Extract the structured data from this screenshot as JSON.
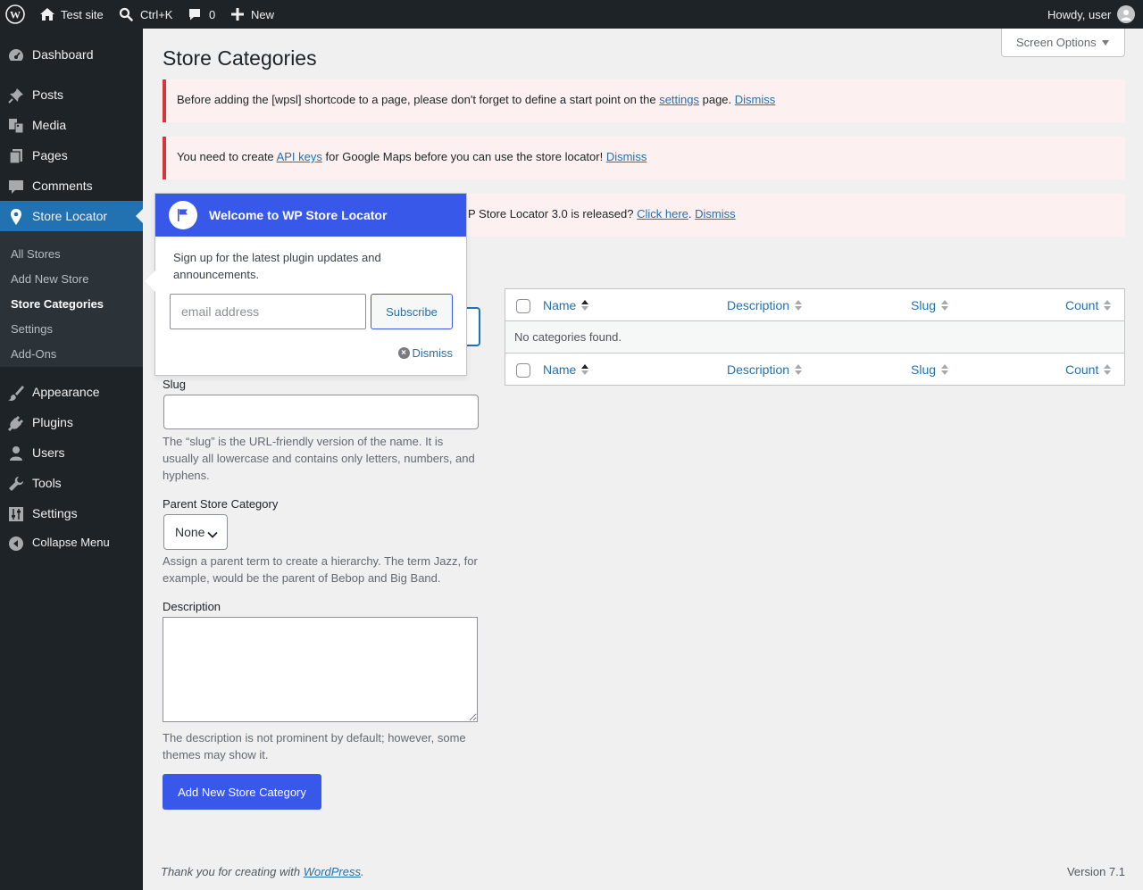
{
  "adminbar": {
    "site_name": "Test site",
    "search_shortcut": "Ctrl+K",
    "comments_count": "0",
    "new_label": "New",
    "howdy": "Howdy, user"
  },
  "sidebar": {
    "items": [
      {
        "label": "Dashboard",
        "icon": "dashboard-icon"
      },
      {
        "label": "Posts",
        "icon": "pin-icon"
      },
      {
        "label": "Media",
        "icon": "media-icon"
      },
      {
        "label": "Pages",
        "icon": "pages-icon"
      },
      {
        "label": "Comments",
        "icon": "comment-icon"
      },
      {
        "label": "Store Locator",
        "icon": "location-pin-icon"
      },
      {
        "label": "Appearance",
        "icon": "brush-icon"
      },
      {
        "label": "Plugins",
        "icon": "plug-icon"
      },
      {
        "label": "Users",
        "icon": "user-icon"
      },
      {
        "label": "Tools",
        "icon": "wrench-icon"
      },
      {
        "label": "Settings",
        "icon": "sliders-icon"
      },
      {
        "label": "Collapse Menu",
        "icon": "collapse-icon"
      }
    ],
    "submenu": [
      "All Stores",
      "Add New Store",
      "Store Categories",
      "Settings",
      "Add-Ons"
    ]
  },
  "page": {
    "title": "Store Categories",
    "screen_options": "Screen Options"
  },
  "notices": {
    "n1_before": "Before adding the [wpsl] shortcode to a page, please don't forget to define a start point on the ",
    "n1_link": "settings",
    "n1_after": " page. ",
    "n2_before": "You need to create ",
    "n2_link": "API keys",
    "n2_after": " for Google Maps before you can use the store locator! ",
    "n3_before": "P Store Locator 3.0 is released? ",
    "n3_link": "Click here",
    "n3_after": ". ",
    "dismiss": "Dismiss"
  },
  "form": {
    "slug_label": "Slug",
    "slug_value": "",
    "slug_help": "The “slug” is the URL-friendly version of the name. It is usually all lowercase and contains only letters, numbers, and hyphens.",
    "parent_label": "Parent Store Category",
    "parent_value": "None",
    "parent_help": "Assign a parent term to create a hierarchy. The term Jazz, for example, would be the parent of Bebop and Big Band.",
    "description_label": "Description",
    "description_value": "",
    "description_help": "The description is not prominent by default; however, some themes may show it.",
    "submit": "Add New Store Category"
  },
  "table": {
    "columns": [
      "Name",
      "Description",
      "Slug",
      "Count"
    ],
    "empty": "No categories found."
  },
  "pointer": {
    "title": "Welcome to WP Store Locator",
    "text": "Sign up for the latest plugin updates and announcements.",
    "email_placeholder": "email address",
    "subscribe": "Subscribe",
    "dismiss": "Dismiss"
  },
  "footer": {
    "thanks_before": "Thank you for creating with ",
    "thanks_link": "WordPress",
    "thanks_after": ".",
    "version": "Version 7.1"
  },
  "colors": {
    "accent": "#3858e9",
    "sidebar_bg": "#1d2327",
    "current_menu": "#2271b1",
    "notice_error": "#d63638"
  }
}
